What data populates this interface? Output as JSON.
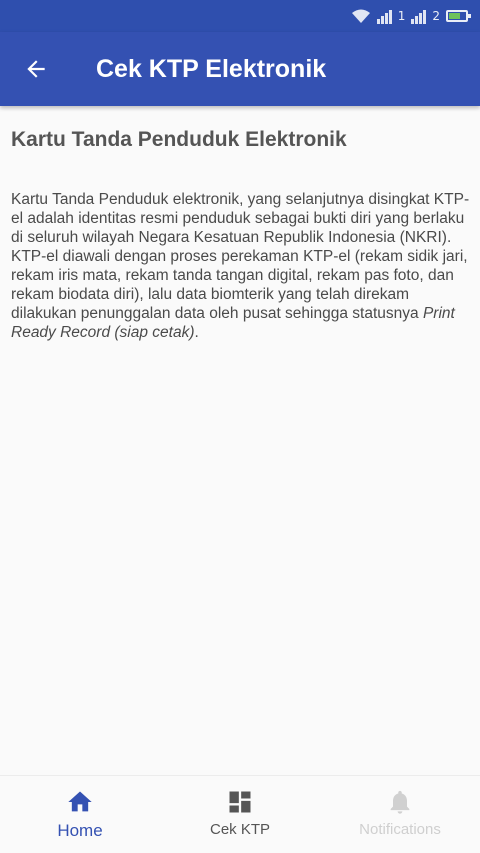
{
  "status_bar": {
    "network_labels": [
      "1",
      "2"
    ],
    "battery_level": 0.6
  },
  "app_bar": {
    "title": "Cek KTP Elektronik",
    "back_icon": "arrow-left-icon",
    "background_color": "#3451b2"
  },
  "content": {
    "heading": "Kartu Tanda Penduduk Elektronik",
    "body_text": "Kartu Tanda Penduduk elektronik, yang selanjutnya disingkat KTP-el adalah identitas resmi penduduk sebagai bukti diri yang berlaku di seluruh wilayah Negara Kesatuan Republik Indonesia (NKRI). KTP-el diawali dengan proses perekaman KTP-el (rekam sidik jari, rekam iris mata, rekam tanda tangan digital, rekam pas foto, dan rekam biodata diri), lalu data biomterik yang telah direkam dilakukan penunggalan data oleh pusat sehingga statusnya ",
    "body_text_italic": "Print Ready Record (siap cetak)",
    "body_text_end": "."
  },
  "bottom_nav": {
    "items": [
      {
        "label": "Home",
        "icon": "home-icon",
        "state": "active"
      },
      {
        "label": "Cek KTP",
        "icon": "dashboard-icon",
        "state": "normal"
      },
      {
        "label": "Notifications",
        "icon": "bell-icon",
        "state": "disabled"
      }
    ],
    "active_color": "#3451b2"
  }
}
